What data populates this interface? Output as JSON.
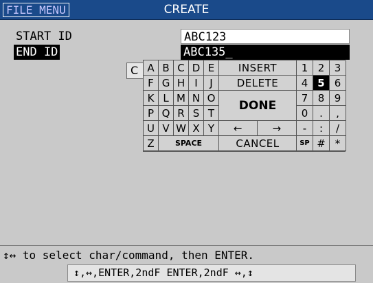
{
  "titlebar": {
    "menu_label": "FILE MENU",
    "title": "CREATE"
  },
  "fields": {
    "start_label": "START ID",
    "start_value": "ABC123",
    "end_label": "END ID",
    "end_value": "ABC135_"
  },
  "hidden_button_label": "C",
  "keyboard": {
    "letters": [
      [
        "A",
        "B",
        "C",
        "D",
        "E"
      ],
      [
        "F",
        "G",
        "H",
        "I",
        "J"
      ],
      [
        "K",
        "L",
        "M",
        "N",
        "O"
      ],
      [
        "P",
        "Q",
        "R",
        "S",
        "T"
      ],
      [
        "U",
        "V",
        "W",
        "X",
        "Y"
      ],
      [
        "Z"
      ]
    ],
    "space_label": "SPACE",
    "commands": {
      "insert": "INSERT",
      "delete": "DELETE",
      "done": "DONE",
      "left_arrow": "←",
      "right_arrow": "→",
      "cancel": "CANCEL"
    },
    "numpad": [
      [
        "1",
        "2",
        "3"
      ],
      [
        "4",
        "5",
        "6"
      ],
      [
        "7",
        "8",
        "9"
      ],
      [
        "0",
        ".",
        ","
      ],
      [
        "-",
        ":",
        "/"
      ],
      [
        "SP",
        "#",
        "*"
      ]
    ],
    "selected_key": "5"
  },
  "help_text": "↕↔ to select char/command, then ENTER.",
  "nav_hint": "↕,↔,ENTER,2ndF ENTER,2ndF ↔,↕"
}
